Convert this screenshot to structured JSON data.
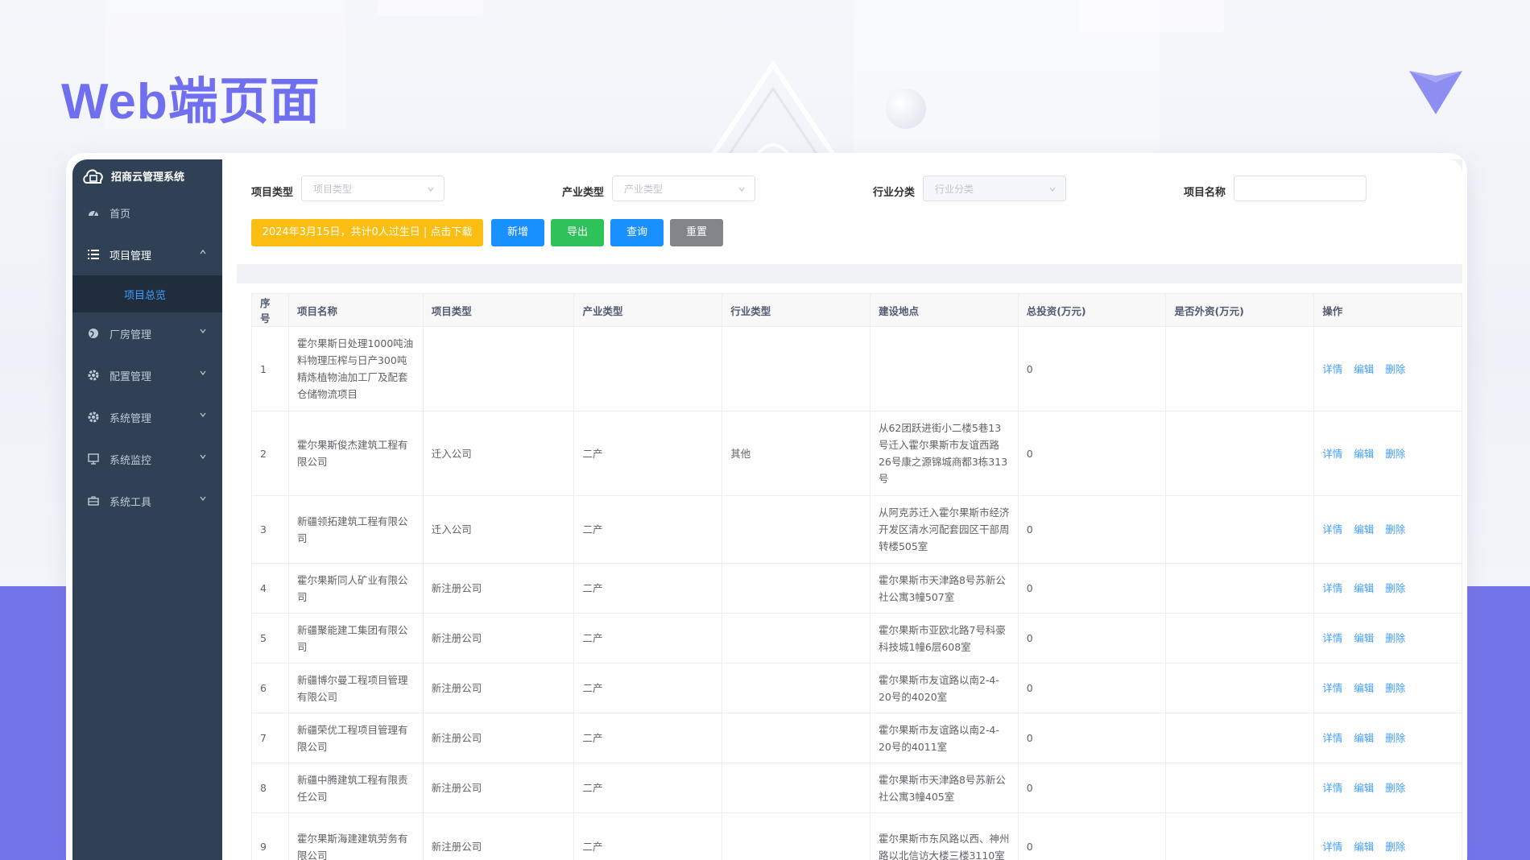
{
  "hero": {
    "title": "Web端页面"
  },
  "sidebar": {
    "brand": "招商云管理系统",
    "items": [
      {
        "label": "首页",
        "icon": "dashboard-icon",
        "expanded": null
      },
      {
        "label": "项目管理",
        "icon": "list-icon",
        "expanded": true,
        "children": [
          {
            "label": "项目总览",
            "active": true
          }
        ]
      },
      {
        "label": "厂房管理",
        "icon": "globe-icon",
        "expanded": false
      },
      {
        "label": "配置管理",
        "icon": "gear-icon",
        "expanded": false
      },
      {
        "label": "系统管理",
        "icon": "gear-icon",
        "expanded": false
      },
      {
        "label": "系统监控",
        "icon": "monitor-icon",
        "expanded": false
      },
      {
        "label": "系统工具",
        "icon": "toolbox-icon",
        "expanded": false
      }
    ]
  },
  "filters": {
    "project_type": {
      "label": "项目类型",
      "placeholder": "项目类型"
    },
    "industry_type": {
      "label": "产业类型",
      "placeholder": "产业类型"
    },
    "sector": {
      "label": "行业分类",
      "placeholder": "行业分类"
    },
    "project_name": {
      "label": "项目名称",
      "value": ""
    }
  },
  "buttons": {
    "birthday": "2024年3月15日，共计0人过生日 | 点击下载",
    "add": "新增",
    "export": "导出",
    "query": "查询",
    "reset": "重置"
  },
  "colors": {
    "band": "#7575eb",
    "sidebar": "#304156",
    "primary": "#409eff",
    "success": "#2fc25b",
    "warning": "#fbbd12",
    "gray": "#82848a"
  },
  "table": {
    "headers": [
      "序号",
      "项目名称",
      "项目类型",
      "产业类型",
      "行业类型",
      "建设地点",
      "总投资(万元)",
      "是否外资(万元)",
      "操作"
    ],
    "actions": [
      "详情",
      "编辑",
      "删除"
    ],
    "rows": [
      {
        "no": "1",
        "name": "霍尔果斯日处理1000吨油料物理压榨与日产300吨精炼植物油加工厂及配套仓储物流项目",
        "ptype": "",
        "itype": "",
        "sector": "",
        "addr": "",
        "invest": "0",
        "foreign": ""
      },
      {
        "no": "2",
        "name": "霍尔果斯俊杰建筑工程有限公司",
        "ptype": "迁入公司",
        "itype": "二产",
        "sector": "其他",
        "addr": "从62团跃进街小二楼5巷13号迁入霍尔果斯市友谊西路26号康之源锦城商都3栋313号",
        "invest": "0",
        "foreign": ""
      },
      {
        "no": "3",
        "name": "新疆领拓建筑工程有限公司",
        "ptype": "迁入公司",
        "itype": "二产",
        "sector": "",
        "addr": "从阿克苏迁入霍尔果斯市经济开发区清水河配套园区干部周转楼505室",
        "invest": "0",
        "foreign": ""
      },
      {
        "no": "4",
        "name": "霍尔果斯同人矿业有限公司",
        "ptype": "新注册公司",
        "itype": "二产",
        "sector": "",
        "addr": "霍尔果斯市天津路8号苏新公社公寓3幢507室",
        "invest": "0",
        "foreign": ""
      },
      {
        "no": "5",
        "name": "新疆聚能建工集团有限公司",
        "ptype": "新注册公司",
        "itype": "二产",
        "sector": "",
        "addr": "霍尔果斯市亚欧北路7号科豪科技城1幢6层608室",
        "invest": "0",
        "foreign": ""
      },
      {
        "no": "6",
        "name": "新疆博尔曼工程项目管理有限公司",
        "ptype": "新注册公司",
        "itype": "二产",
        "sector": "",
        "addr": "霍尔果斯市友谊路以南2-4-20号的4020室",
        "invest": "0",
        "foreign": ""
      },
      {
        "no": "7",
        "name": "新疆荣优工程项目管理有限公司",
        "ptype": "新注册公司",
        "itype": "二产",
        "sector": "",
        "addr": "霍尔果斯市友谊路以南2-4-20号的4011室",
        "invest": "0",
        "foreign": ""
      },
      {
        "no": "8",
        "name": "新疆中腾建筑工程有限责任公司",
        "ptype": "新注册公司",
        "itype": "二产",
        "sector": "",
        "addr": "霍尔果斯市天津路8号苏新公社公寓3幢405室",
        "invest": "0",
        "foreign": ""
      },
      {
        "no": "9",
        "name": "霍尔果斯海建建筑劳务有限公司",
        "ptype": "新注册公司",
        "itype": "二产",
        "sector": "",
        "addr": "霍尔果斯市东风路以西、神州路以北信访大楼三楼3110室",
        "invest": "0",
        "foreign": ""
      }
    ]
  }
}
